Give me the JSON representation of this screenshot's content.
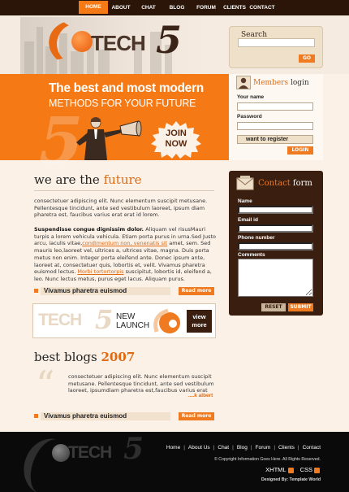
{
  "nav": {
    "items": [
      {
        "label": "HOME",
        "active": true
      },
      {
        "label": "ABOUT US"
      },
      {
        "label": "CHAT"
      },
      {
        "label": "BLOG"
      },
      {
        "label": "FORUM"
      },
      {
        "label": "CLIENTS"
      },
      {
        "label": "CONTACT"
      }
    ]
  },
  "logo": {
    "text": "TECH",
    "digit": "5"
  },
  "search": {
    "title": "Search",
    "placeholder": "",
    "go_label": "GO"
  },
  "banner": {
    "headline": "The best and most modern",
    "subline": "METHODS FOR YOUR FUTURE",
    "join_line1": "JOIN",
    "join_line2": "NOW"
  },
  "members": {
    "title_accent": "Members",
    "title_rest": "login",
    "name_label": "Your name",
    "password_label": "Password",
    "register_label": "want to register",
    "login_label": "LOGIN"
  },
  "intro": {
    "heading_plain": "we are the ",
    "heading_accent": "future",
    "para1": "consectetuer adipiscing elit. Nunc elementum suscipit metusane. Pellentesque tincidunt, ante sed vestibulum laoreet, ipsum diam pharetra est, faucibus varius erat erat id lorem.",
    "para2_bold": "Suspendisse congue dignissim dolor.",
    "para2_a": " Aliquam vel risusMauri turpis a lorem vehicula vehicula. Etiam porta purus in urna.Sed Justo arcu, iaculis vitae,",
    "para2_link1": "condimentum non, venenatis sit",
    "para2_b": " amet, sem. Sed mauris leo,laoreet vel, ultrices a, ultrices vitae, magna. Duis porta metus non enim. Integer porta eleifend ante. Donec ipsum ante, laoreet at, consectetuer quis, lobortis et, velit. Vivamus pharetra euismod lectus.",
    "para2_link2": "Morbi tortortorpis",
    "para2_c": " suscipitut, lobortis id, eleifend a, leo. Nunc lectus metus, purus eget lacus. Aliquam purus.",
    "more_label": "Vivamus pharetra euismod",
    "more_btn": "Read more"
  },
  "ad": {
    "brand": "TECH",
    "digit": "5",
    "new_line1": "NEW",
    "new_line2": "LAUNCH",
    "view_line1": "view",
    "view_line2": "more"
  },
  "blogs": {
    "heading_plain": "best blogs ",
    "heading_accent": "2007",
    "quote": "consectetuer adipiscing elit. Nunc elementum suscipit metusane. Pellentesque tincidunt, ante sed vestibulum laoreet, ipsumdiam pharetra est,faucibus varius erat",
    "author": "....k albert",
    "more_label": "Vivamus pharetra euismod",
    "more_btn": "Read more"
  },
  "contact": {
    "title_accent": "Contact",
    "title_rest": "form",
    "name_label": "Name",
    "email_label": "Email id",
    "phone_label": "Phone number",
    "comments_label": "Comments",
    "reset_label": "RESET",
    "submit_label": "SUBMIT"
  },
  "footer": {
    "links": [
      "Home",
      "About Us",
      "Chat",
      "Blog",
      "Forum",
      "Clients",
      "Contact"
    ],
    "copyright": "© Copyright Information Goes Here. All Rights Reserved.",
    "xhtml": "XHTML",
    "css": "CSS",
    "designed": "Designed By: Template World"
  },
  "colors": {
    "accent": "#f57a16",
    "dark": "#3a1e10",
    "bg": "#fbf1e7"
  }
}
